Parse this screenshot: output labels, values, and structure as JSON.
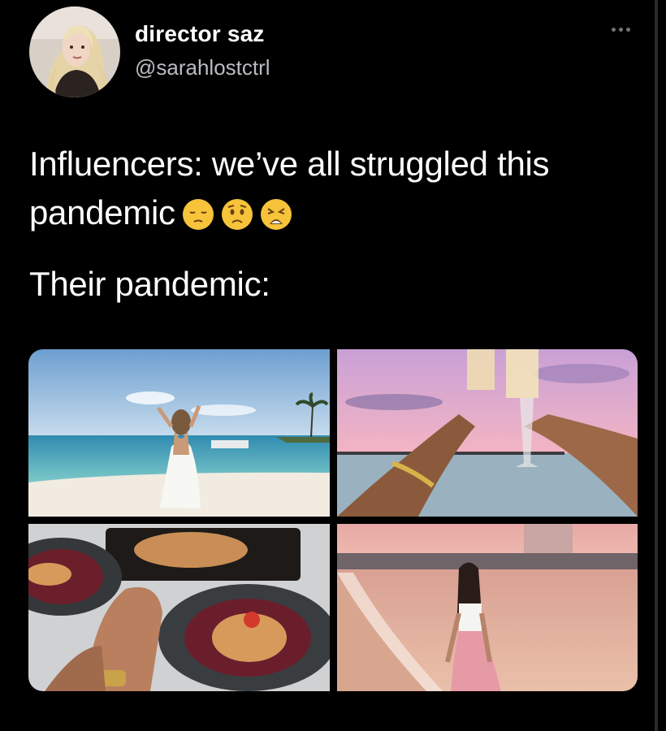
{
  "tweet": {
    "display_name": "director saz",
    "handle": "@sarahlostctrl",
    "line1": "Influencers: we’ve all struggled this",
    "line2": "pandemic",
    "line3": "Their pandemic:",
    "emojis": [
      "pensive-face-emoji",
      "worried-face-emoji",
      "tired-face-emoji"
    ],
    "more_icon": "more-dots-icon"
  },
  "media": [
    {
      "name": "photo-beach-woman-white-dress"
    },
    {
      "name": "photo-champagne-toast-sunset"
    },
    {
      "name": "photo-restaurant-dinner-plates"
    },
    {
      "name": "photo-woman-pink-skirt-sunset-beach"
    }
  ],
  "colors": {
    "background": "#000000",
    "handle": "#b9bcc0",
    "more_icon": "#6e7378"
  }
}
